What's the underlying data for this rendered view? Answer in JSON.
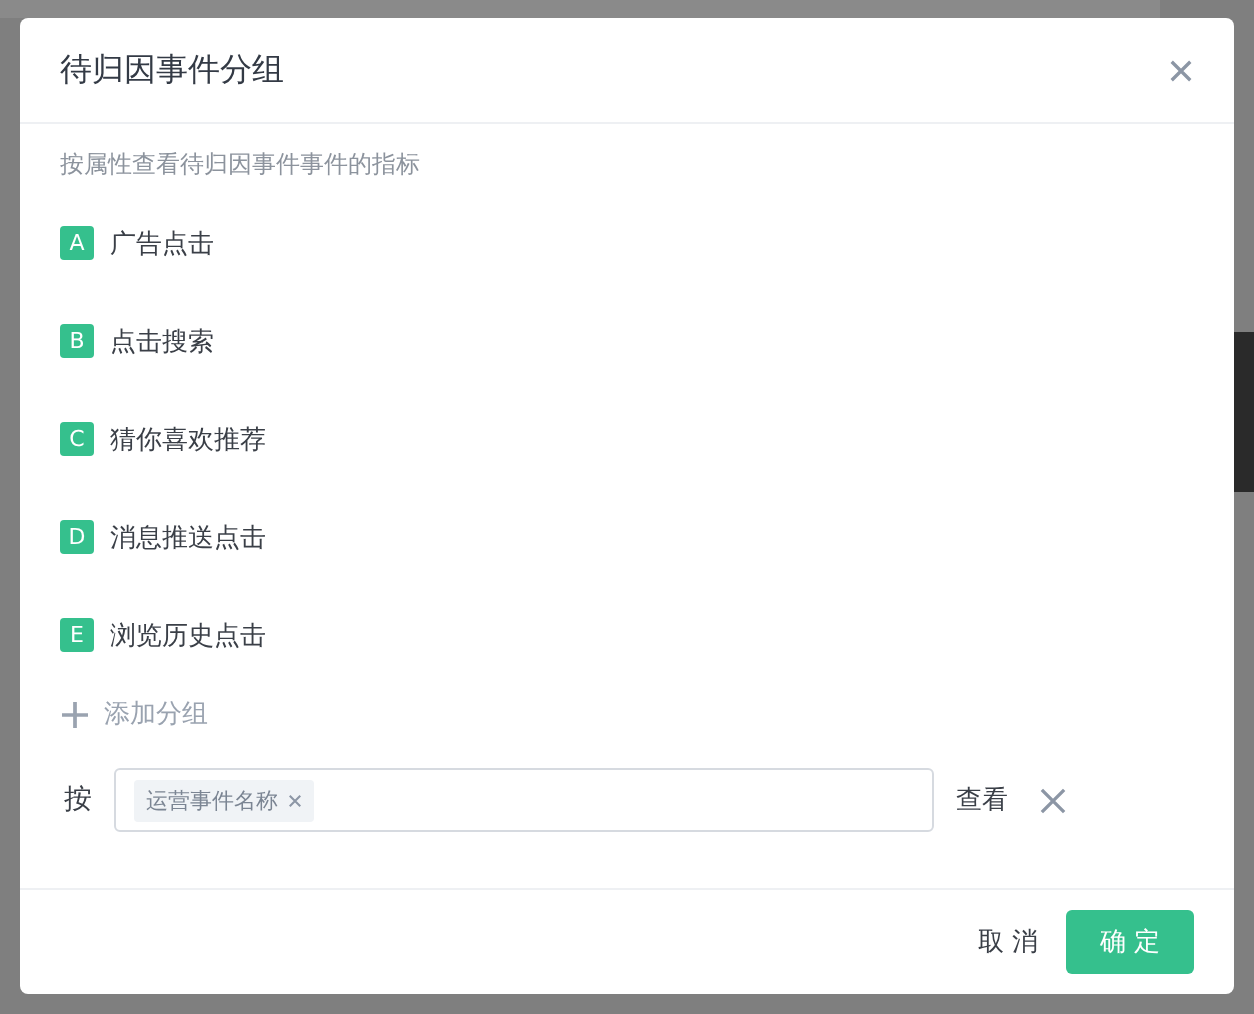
{
  "dialog": {
    "title": "待归因事件分组",
    "subtitle": "按属性查看待归因事件事件的指标",
    "groups": [
      {
        "letter": "A",
        "name": "广告点击"
      },
      {
        "letter": "B",
        "name": "点击搜索"
      },
      {
        "letter": "C",
        "name": "猜你喜欢推荐"
      },
      {
        "letter": "D",
        "name": "消息推送点击"
      },
      {
        "letter": "E",
        "name": "浏览历史点击"
      }
    ],
    "add_group": "添加分组",
    "filter": {
      "prefix": "按",
      "tags": [
        "运营事件名称"
      ],
      "suffix": "查看"
    },
    "buttons": {
      "cancel": "取 消",
      "confirm": "确 定"
    }
  }
}
